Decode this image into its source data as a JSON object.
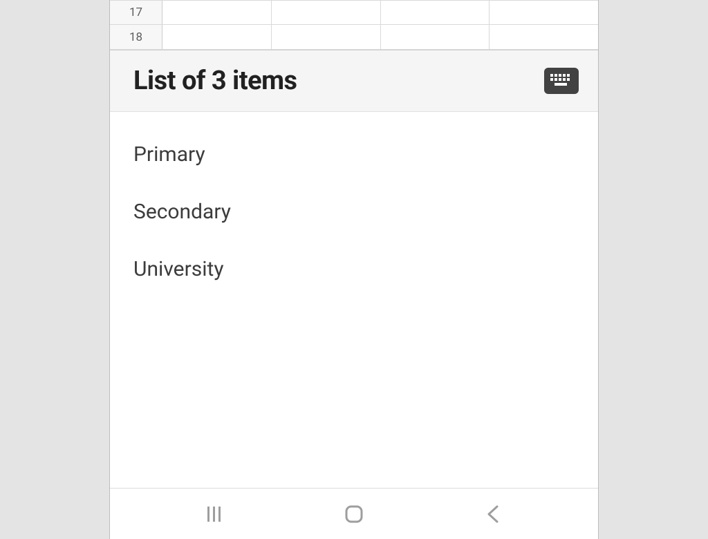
{
  "sheet": {
    "rows": [
      "17",
      "18"
    ]
  },
  "panel": {
    "title": "List of 3 items",
    "items": [
      "Primary",
      "Secondary",
      "University"
    ]
  }
}
